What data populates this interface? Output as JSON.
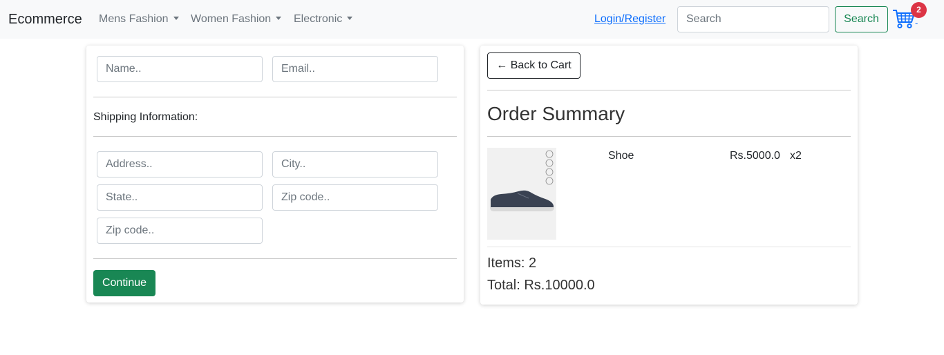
{
  "navbar": {
    "brand": "Ecommerce",
    "menus": [
      {
        "label": "Mens Fashion"
      },
      {
        "label": "Women Fashion"
      },
      {
        "label": "Electronic"
      }
    ],
    "login_label": "Login/Register",
    "search_placeholder": "Search",
    "search_button": "Search",
    "cart_count": "2",
    "cart_suffix": "-"
  },
  "form": {
    "name_placeholder": "Name..",
    "email_placeholder": "Email..",
    "shipping_heading": "Shipping Information:",
    "address_placeholder": "Address..",
    "city_placeholder": "City..",
    "state_placeholder": "State..",
    "zip_placeholder": "Zip code..",
    "zip2_placeholder": "Zip code..",
    "continue_label": "Continue"
  },
  "summary": {
    "back_label": "← Back to Cart",
    "title": "Order Summary",
    "items": [
      {
        "name": "Shoe",
        "price": "Rs.5000.0",
        "qty": "x2"
      }
    ],
    "items_text": "Items: 2",
    "total_text": "Total: Rs.10000.0"
  },
  "colors": {
    "primary": "#0d6efd",
    "success": "#198754",
    "danger": "#dc3545",
    "navbar_bg": "#f8f9fa"
  }
}
